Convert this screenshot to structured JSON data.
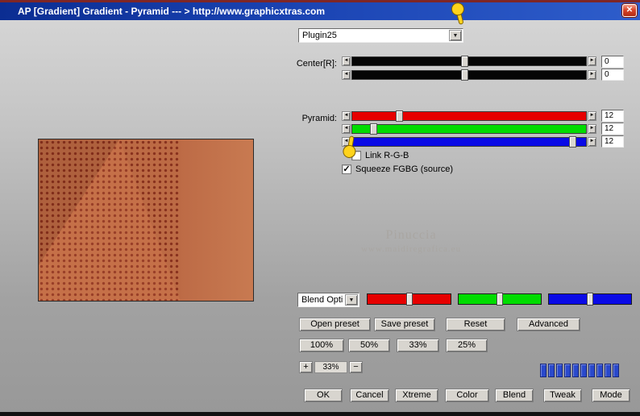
{
  "window": {
    "title": "AP [Gradient]  Gradient - Pyramid   --- > http://www.graphicxtras.com"
  },
  "icons": {
    "close": "✕",
    "dropdown": "▼",
    "check": "✓",
    "arrow_left": "◄",
    "arrow_right": "►"
  },
  "controls": {
    "plugin_dropdown_value": "Plugin25",
    "center_label": "Center[R]:",
    "center_values": [
      "0",
      "0"
    ],
    "pyramid_label": "Pyramid:",
    "pyramid_values": [
      "12",
      "12",
      "12"
    ],
    "link_rgb_label": "Link R-G-B",
    "link_rgb_checked": false,
    "squeeze_label": "Squeeze FGBG (source)",
    "squeeze_checked": true,
    "blend_dropdown_value": "Blend Opti"
  },
  "watermark": {
    "line1": "Pinuccia",
    "line2": "www.maidiregrafica.eu"
  },
  "buttons": {
    "open_preset": "Open preset",
    "save_preset": "Save preset",
    "reset": "Reset",
    "advanced": "Advanced",
    "zoom_100": "100%",
    "zoom_50": "50%",
    "zoom_33": "33%",
    "zoom_25": "25%",
    "zoom_plus": "+",
    "zoom_value": "33%",
    "zoom_minus": "−",
    "ok": "OK",
    "cancel": "Cancel",
    "xtreme": "Xtreme",
    "color": "Color",
    "blend": "Blend",
    "tweak": "Tweak",
    "mode": "Mode"
  },
  "progress": {
    "segments": 10
  },
  "colors": {
    "slider-red": "#e60000",
    "slider-green": "#00dc00",
    "slider-blue": "#0a0ae6",
    "progress-segment": "#2a49cc",
    "titlebar": "#1a43b2"
  }
}
